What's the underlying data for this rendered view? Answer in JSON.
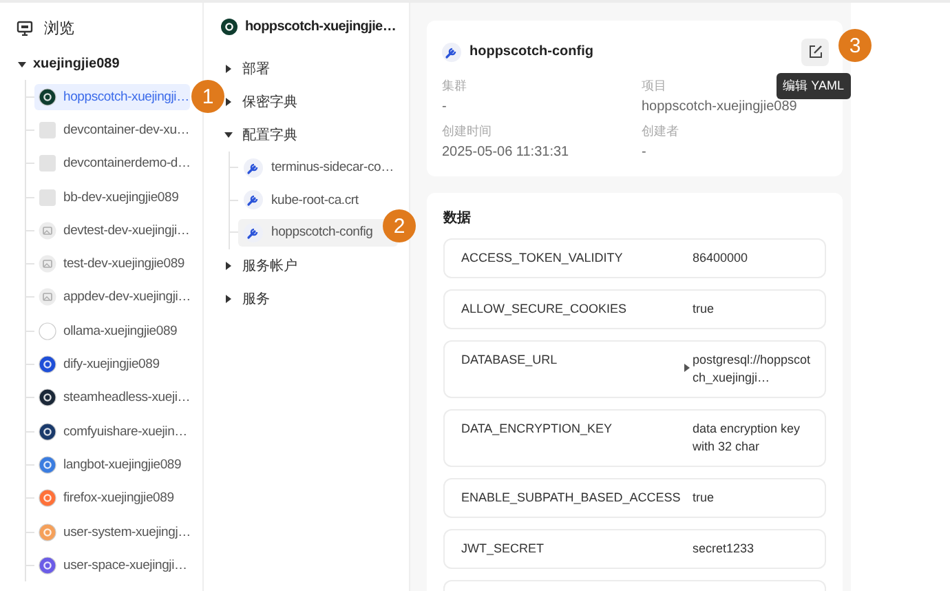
{
  "sidebar": {
    "title": "浏览",
    "group": {
      "label": "xuejingjie089",
      "expanded": true,
      "items": [
        {
          "label": "hoppscotch-xuejingji…",
          "kind": "logo",
          "color": "#0f3d2f",
          "selected": true
        },
        {
          "label": "devcontainer-dev-xu…",
          "kind": "blank",
          "selected": false
        },
        {
          "label": "devcontainerdemo-d…",
          "kind": "blank",
          "selected": false
        },
        {
          "label": "bb-dev-xuejingjie089",
          "kind": "blank",
          "selected": false
        },
        {
          "label": "devtest-dev-xuejingji…",
          "kind": "image",
          "selected": false
        },
        {
          "label": "test-dev-xuejingjie089",
          "kind": "image",
          "selected": false
        },
        {
          "label": "appdev-dev-xuejingji…",
          "kind": "image",
          "selected": false
        },
        {
          "label": "ollama-xuejingjie089",
          "kind": "logo",
          "color": "#ffffff",
          "selected": false
        },
        {
          "label": "dify-xuejingjie089",
          "kind": "logo",
          "color": "#1f4fd8",
          "selected": false
        },
        {
          "label": "steamheadless-xueji…",
          "kind": "logo",
          "color": "#1b2838",
          "selected": false
        },
        {
          "label": "comfyuishare-xuejin…",
          "kind": "logo",
          "color": "#1a3a6b",
          "selected": false
        },
        {
          "label": "langbot-xuejingjie089",
          "kind": "logo",
          "color": "#3b7de0",
          "selected": false
        },
        {
          "label": "firefox-xuejingjie089",
          "kind": "logo",
          "color": "#ff7139",
          "selected": false
        },
        {
          "label": "user-system-xuejingj…",
          "kind": "logo",
          "color": "#f5a05a",
          "selected": false
        },
        {
          "label": "user-space-xuejingji…",
          "kind": "logo",
          "color": "#6b5ce7",
          "selected": false
        }
      ]
    }
  },
  "resource_tree": {
    "title": "hoppscotch-xuejingjie…",
    "sections": [
      {
        "label": "部署",
        "expanded": false
      },
      {
        "label": "保密字典",
        "expanded": false
      },
      {
        "label": "配置字典",
        "expanded": true,
        "children": [
          {
            "label": "terminus-sidecar-co…",
            "selected": false
          },
          {
            "label": "kube-root-ca.crt",
            "selected": false
          },
          {
            "label": "hoppscotch-config",
            "selected": true
          }
        ]
      },
      {
        "label": "服务帐户",
        "expanded": false
      },
      {
        "label": "服务",
        "expanded": false
      }
    ]
  },
  "detail": {
    "title": "hoppscotch-config",
    "fields": [
      {
        "label": "集群",
        "value": "-"
      },
      {
        "label": "项目",
        "value": "hoppscotch-xuejingjie089"
      },
      {
        "label": "创建时间",
        "value": "2025-05-06 11:31:31"
      },
      {
        "label": "创建者",
        "value": "-"
      }
    ],
    "edit_tooltip": "编辑 YAML"
  },
  "data": {
    "title": "数据",
    "entries": [
      {
        "key": "ACCESS_TOKEN_VALIDITY",
        "value": "86400000",
        "expandable": false
      },
      {
        "key": "ALLOW_SECURE_COOKIES",
        "value": "true",
        "expandable": false
      },
      {
        "key": "DATABASE_URL",
        "value": "postgresql://hoppscotch_xuejingji…",
        "expandable": true
      },
      {
        "key": "DATA_ENCRYPTION_KEY",
        "value": "data encryption key with 32 char",
        "expandable": false
      },
      {
        "key": "ENABLE_SUBPATH_BASED_ACCESS",
        "value": "true",
        "expandable": false
      },
      {
        "key": "JWT_SECRET",
        "value": "secret1233",
        "expandable": false
      }
    ]
  },
  "step_badges": [
    "1",
    "2",
    "3"
  ]
}
